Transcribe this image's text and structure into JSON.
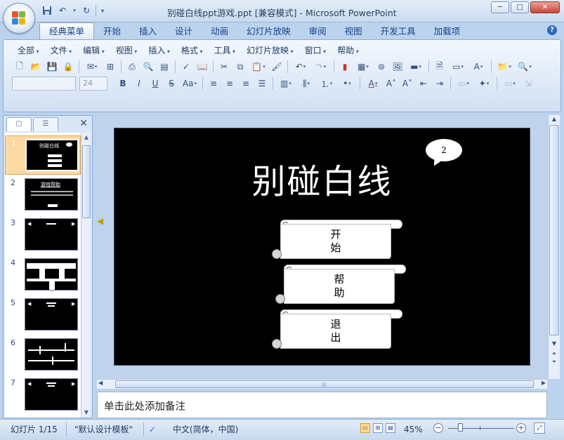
{
  "window": {
    "title": "别碰白线ppt游戏.ppt [兼容模式] - Microsoft PowerPoint"
  },
  "quick_access": {
    "icons": [
      "save-icon",
      "undo-icon",
      "redo-icon",
      "customize-icon"
    ]
  },
  "ribbon": {
    "tabs": [
      {
        "label": "经典菜单",
        "active": true
      },
      {
        "label": "开始"
      },
      {
        "label": "插入"
      },
      {
        "label": "设计"
      },
      {
        "label": "动画"
      },
      {
        "label": "幻灯片放映"
      },
      {
        "label": "审阅"
      },
      {
        "label": "视图"
      },
      {
        "label": "开发工具"
      },
      {
        "label": "加载项"
      }
    ],
    "menus": [
      "全部",
      "文件",
      "编辑",
      "视图",
      "插入",
      "格式",
      "工具",
      "幻灯片放映",
      "窗口",
      "帮助"
    ],
    "font_size": "24"
  },
  "thumbnails": [
    {
      "num": "1",
      "selected": true,
      "title": "别碰白线"
    },
    {
      "num": "2",
      "title": "游戏帮助"
    },
    {
      "num": "3"
    },
    {
      "num": "4"
    },
    {
      "num": "5"
    },
    {
      "num": "6"
    },
    {
      "num": "7"
    }
  ],
  "slide": {
    "title": "别碰白线",
    "bubble": "2",
    "buttons": [
      {
        "label": [
          "开",
          "始"
        ]
      },
      {
        "label": [
          "帮",
          "助"
        ]
      },
      {
        "label": [
          "退",
          "出"
        ]
      }
    ]
  },
  "notes": {
    "placeholder": "单击此处添加备注"
  },
  "status": {
    "slide_pos": "幻灯片 1/15",
    "template": "\"默认设计模板\"",
    "language": "中文(简体，中国)",
    "zoom": "45%"
  },
  "colors": {
    "accent": "#15428b",
    "selected_thumb": "#fcd9a3"
  }
}
